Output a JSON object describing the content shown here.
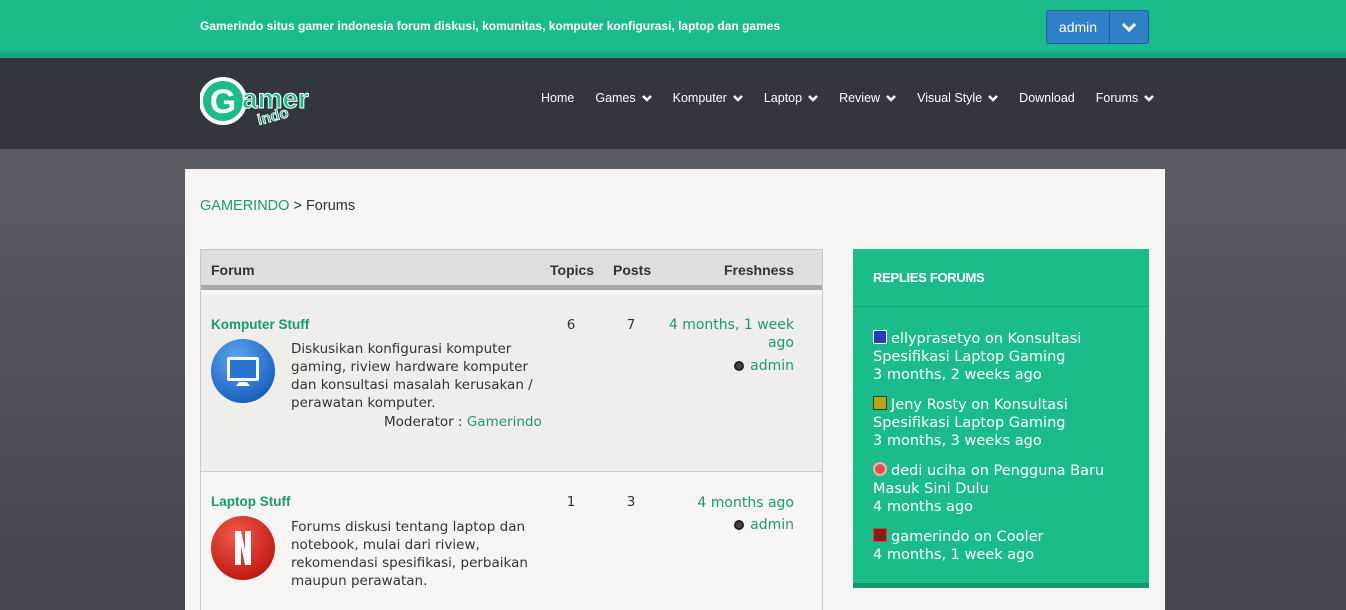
{
  "topbar": {
    "tagline": "Gamerindo situs gamer indonesia forum diskusi, komunitas, komputer konfigurasi, laptop dan games",
    "user_button": "admin"
  },
  "logo": {
    "text": "Gamer",
    "sub": "indo"
  },
  "nav": [
    {
      "label": "Home",
      "has_caret": false
    },
    {
      "label": "Games",
      "has_caret": true
    },
    {
      "label": "Komputer",
      "has_caret": true
    },
    {
      "label": "Laptop",
      "has_caret": true
    },
    {
      "label": "Review",
      "has_caret": true
    },
    {
      "label": "Visual Style",
      "has_caret": true
    },
    {
      "label": "Download",
      "has_caret": false
    },
    {
      "label": "Forums",
      "has_caret": true
    }
  ],
  "breadcrumb": {
    "home": "GAMERINDO",
    "separator": " > ",
    "current": "Forums"
  },
  "forum_table": {
    "headers": {
      "forum": "Forum",
      "topics": "Topics",
      "posts": "Posts",
      "freshness": "Freshness"
    },
    "rows": [
      {
        "title": "Komputer Stuff",
        "icon": "monitor-icon",
        "description": "Diskusikan konfigurasi komputer gaming, riview hardware komputer dan konsultasi masalah kerusakan / perawatan komputer.",
        "moderator_label": "Moderator : ",
        "moderator": "Gamerindo",
        "topics": "6",
        "posts": "7",
        "freshness": "4 months, 1 week ago",
        "last_user": "admin"
      },
      {
        "title": "Laptop Stuff",
        "icon": "netflix-n-icon",
        "description": "Forums diskusi tentang laptop dan notebook, mulai dari riview, rekomendasi spesifikasi, perbaikan maupun perawatan.",
        "topics": "1",
        "posts": "3",
        "freshness": "4 months ago",
        "last_user": "admin"
      }
    ]
  },
  "replies": {
    "title": "REPLIES FORUMS",
    "items": [
      {
        "user": "ellyprasetyo",
        "on": " on ",
        "topic": "Konsultasi Spesifikasi Laptop Gaming",
        "time": "3 months, 2 weeks ago"
      },
      {
        "user": "Jeny Rosty",
        "on": " on ",
        "topic": "Konsultasi Spesifikasi Laptop Gaming",
        "time": "3 months, 3 weeks ago"
      },
      {
        "user": "dedi uciha",
        "on": " on ",
        "topic": "Pengguna Baru Masuk Sini Dulu",
        "time": "4 months ago"
      },
      {
        "user": "gamerindo",
        "on": " on ",
        "topic": "Cooler",
        "time": "4 months, 1 week ago"
      }
    ]
  },
  "colors": {
    "green": "#1abc8c",
    "dark_header": "#33363d",
    "link_green": "#1a9b6e",
    "user_button": "#2f80c8"
  }
}
